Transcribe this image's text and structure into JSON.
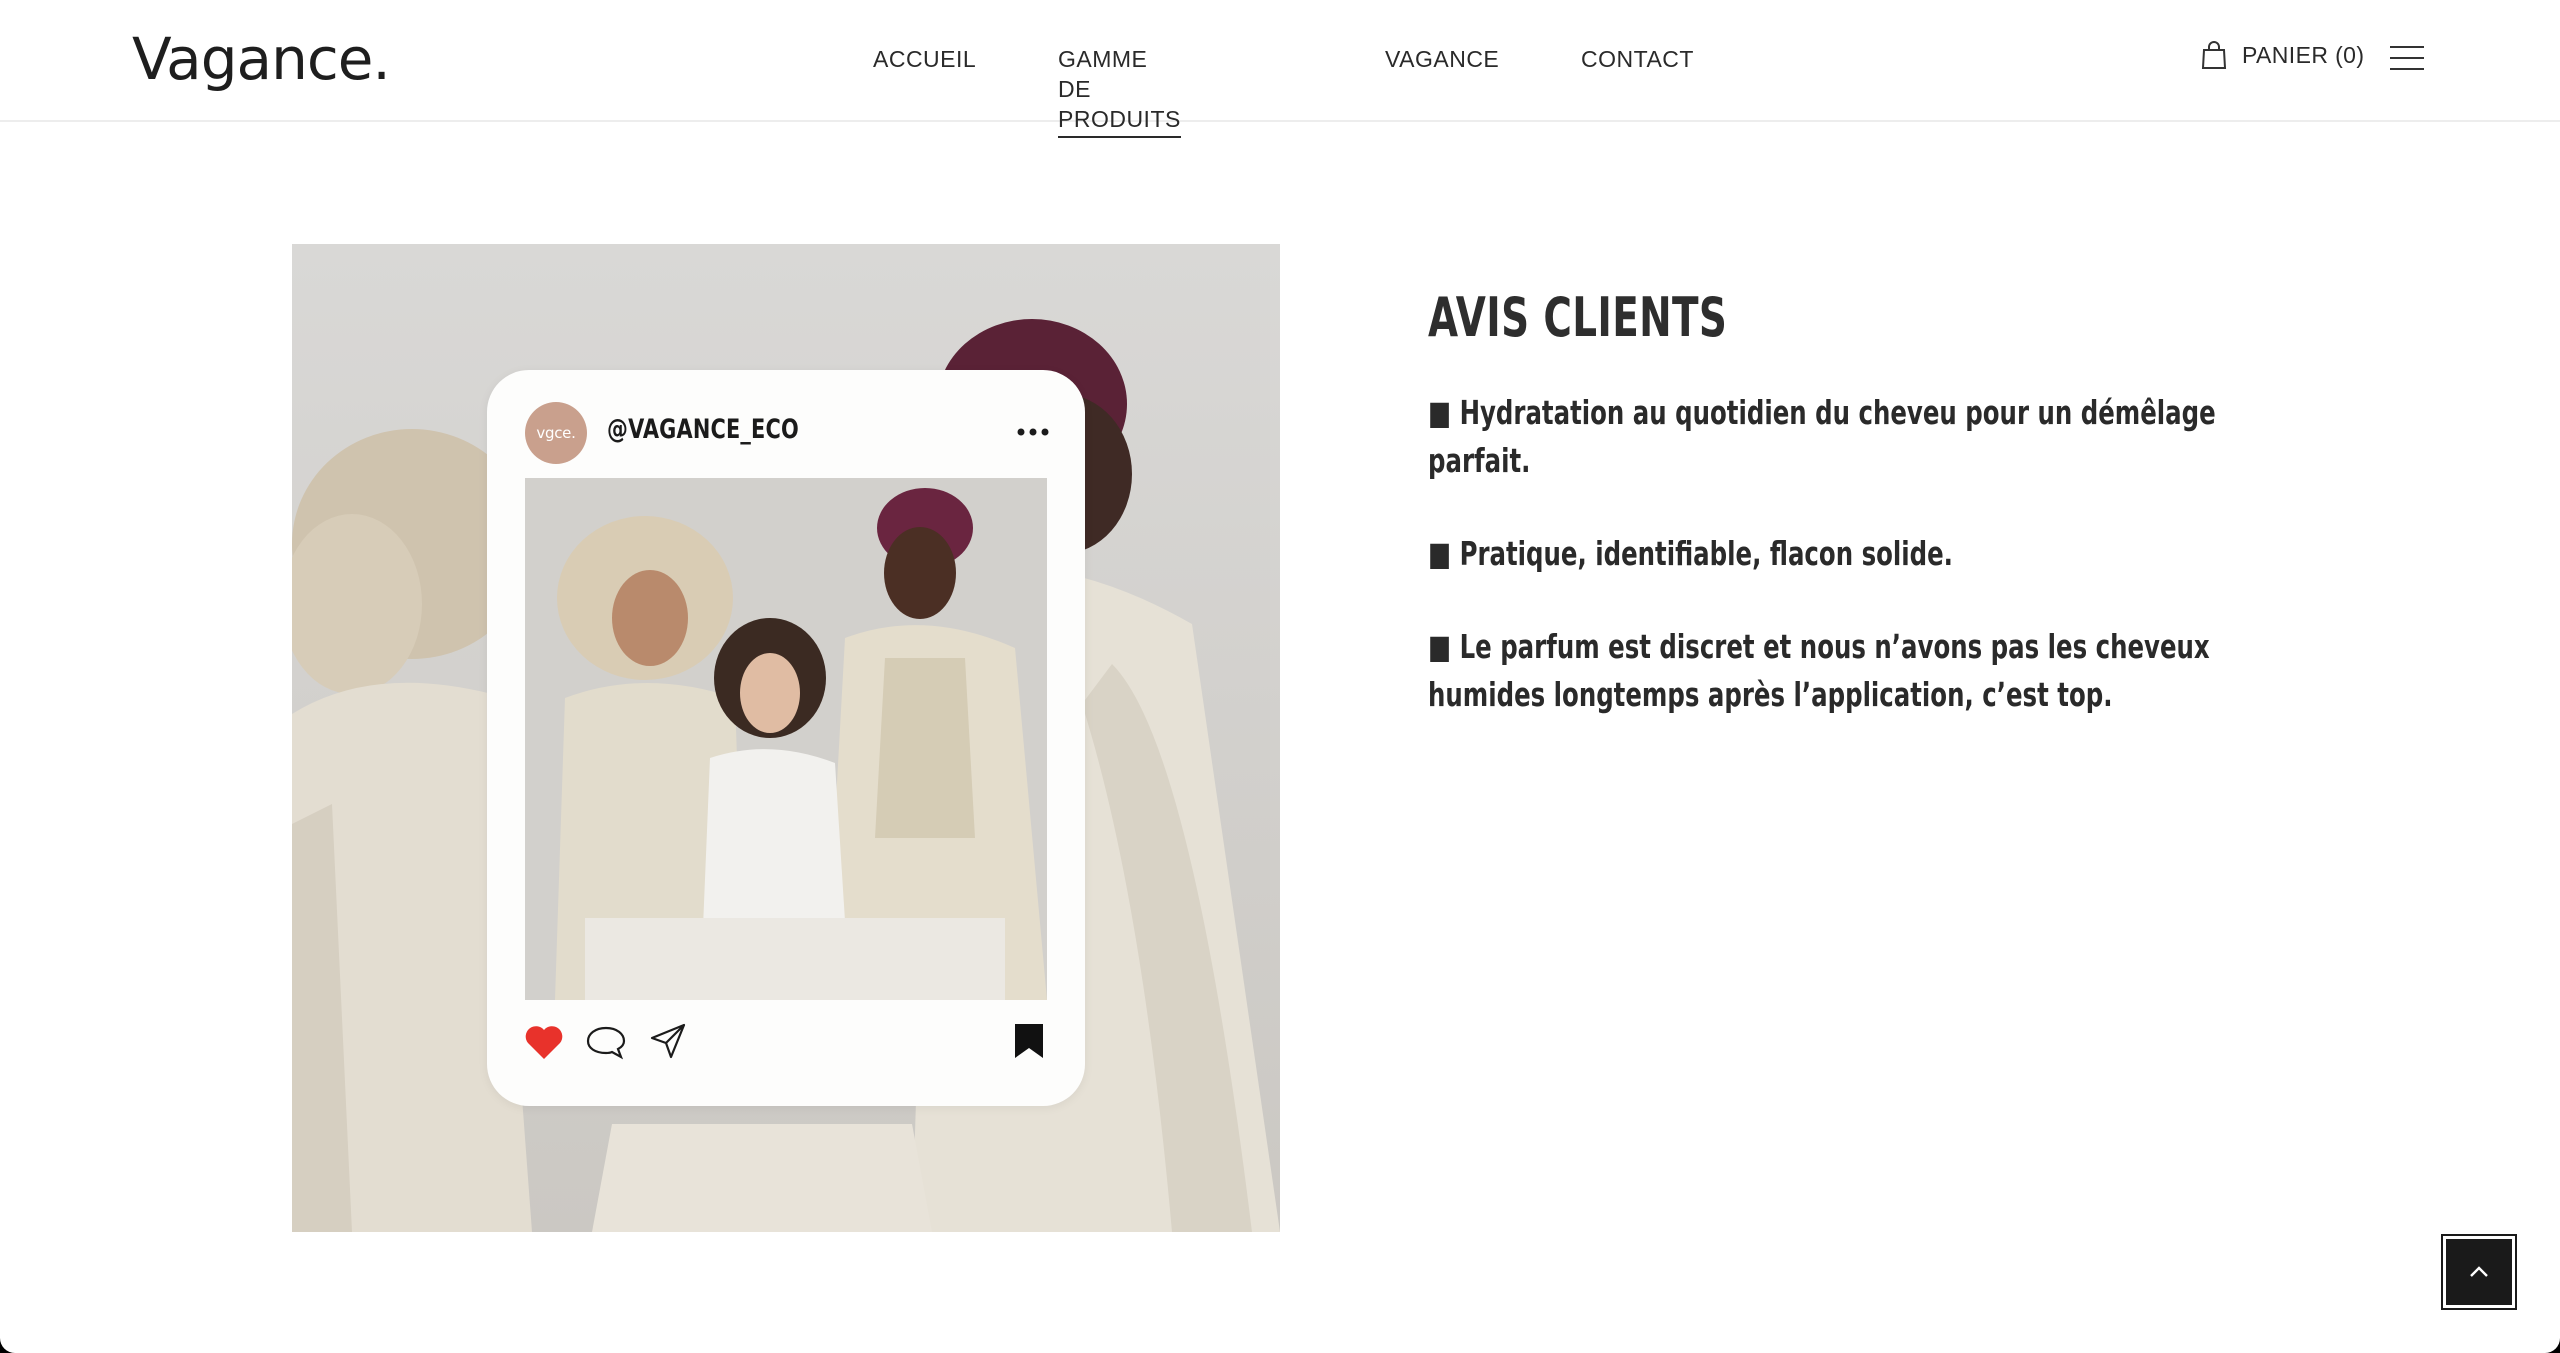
{
  "header": {
    "logo": "Vagance.",
    "nav": [
      {
        "label": "ACCUEIL",
        "active": false
      },
      {
        "label": "GAMME DE PRODUITS",
        "active": true
      },
      {
        "label": "VAGANCE",
        "active": false
      },
      {
        "label": "CONTACT",
        "active": false
      }
    ],
    "cart_label": "PANIER (0)",
    "cart_icon": "shopping-bag-icon",
    "menu_icon": "hamburger-menu-icon"
  },
  "instagram_card": {
    "avatar_text": "vgce.",
    "handle": "@VAGANCE_ECO",
    "icons": [
      "more-icon",
      "heart-icon",
      "comment-icon",
      "share-icon",
      "bookmark-icon"
    ],
    "heart_color": "#e8322b"
  },
  "reviews": {
    "title": "AVIS CLIENTS",
    "items": [
      "■ Hydratation au quotidien du cheveu pour un démêlage parfait.",
      "■ Pratique, identifiable, flacon solide.",
      "■ Le parfum est discret et nous n’avons pas les cheveux humides longtemps après l’application, c’est top."
    ]
  },
  "back_to_top_icon": "chevron-up-icon",
  "colors": {
    "text": "#2a2a2a",
    "background": "#ffffff",
    "accent_dark": "#1a1a1a",
    "avatar": "#c9a08d"
  }
}
